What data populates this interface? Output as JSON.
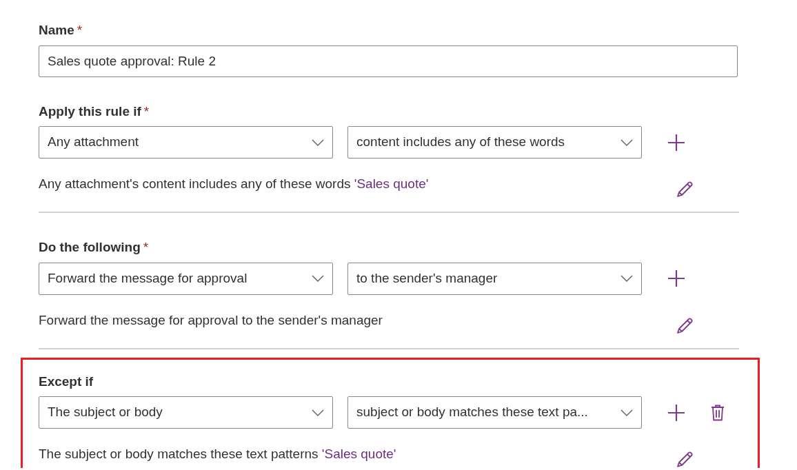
{
  "name_field": {
    "label": "Name",
    "required_mark": "*",
    "value": "Sales quote approval: Rule 2"
  },
  "sections": [
    {
      "label": "Apply this rule if",
      "required_mark": "*",
      "highlighted": false,
      "dropdowns": [
        "Any attachment",
        "content includes any of these words"
      ],
      "deletable": false,
      "summary": "Any attachment's content includes any of these words",
      "summary_link": "'Sales quote'"
    },
    {
      "label": "Do the following",
      "required_mark": "*",
      "highlighted": false,
      "dropdowns": [
        "Forward the message for approval",
        "to the sender's manager"
      ],
      "deletable": false,
      "summary": "Forward the message for approval to the sender's manager"
    },
    {
      "label": "Except if",
      "highlighted": true,
      "dropdowns": [
        "The subject or body",
        "subject or body matches these text pa..."
      ],
      "deletable": true,
      "summary": "The subject or body matches these text patterns",
      "summary_link": "'Sales quote'"
    }
  ]
}
